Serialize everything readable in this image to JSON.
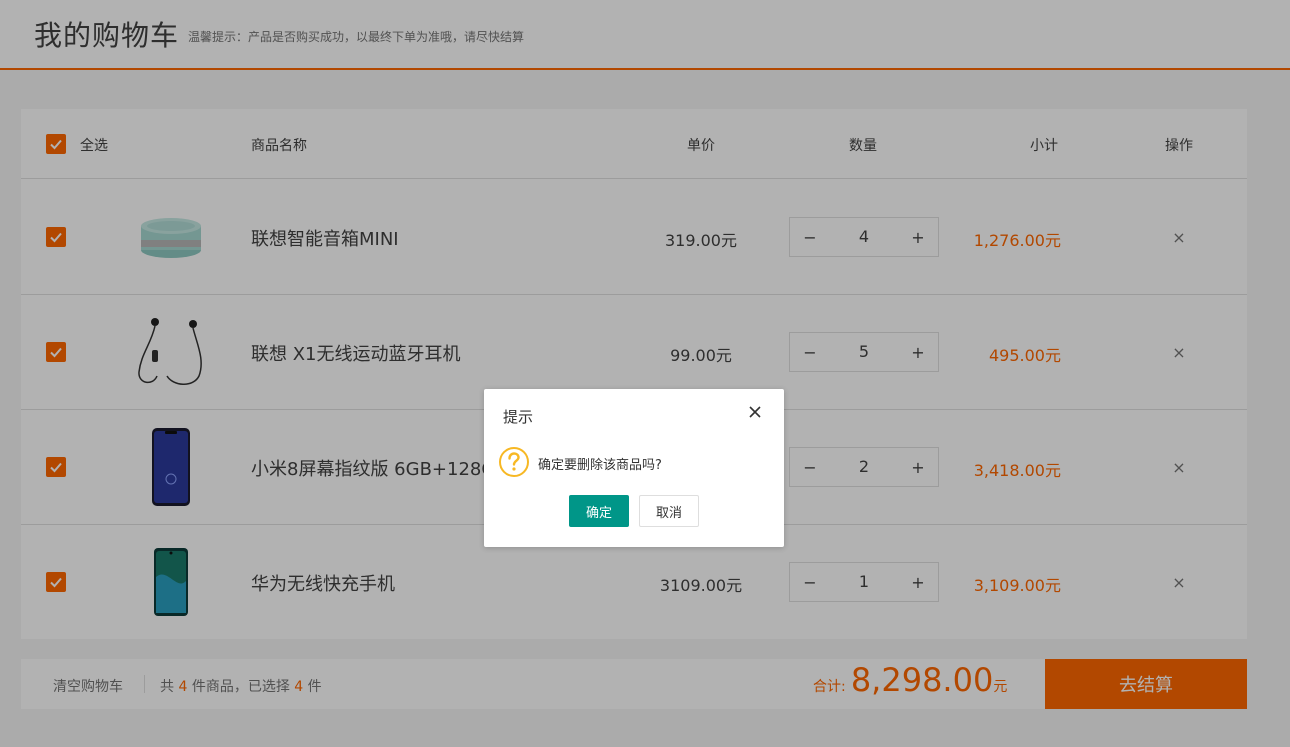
{
  "header": {
    "title": "我的购物车",
    "tip": "温馨提示：产品是否购买成功，以最终下单为准哦，请尽快结算"
  },
  "table_head": {
    "select_all": "全选",
    "name": "商品名称",
    "price": "单价",
    "quantity": "数量",
    "subtotal": "小计",
    "action": "操作"
  },
  "items": [
    {
      "name": "联想智能音箱MINI",
      "price": "319.00元",
      "qty": "4",
      "subtotal": "1,276.00元",
      "checked": true,
      "image": "smart-speaker"
    },
    {
      "name": "联想 X1无线运动蓝牙耳机",
      "price": "99.00元",
      "qty": "5",
      "subtotal": "495.00元",
      "checked": true,
      "image": "earphones"
    },
    {
      "name": "小米8屏幕指纹版 6GB+128GB",
      "price": "",
      "qty": "2",
      "subtotal": "3,418.00元",
      "checked": true,
      "image": "phone"
    },
    {
      "name": "华为无线快充手机",
      "price": "3109.00元",
      "qty": "1",
      "subtotal": "3,109.00元",
      "checked": true,
      "image": "phone"
    }
  ],
  "stepper": {
    "minus": "−",
    "plus": "+"
  },
  "delete_symbol": "×",
  "footer": {
    "clear": "清空购物车",
    "count_prefix": "共 ",
    "count_total": "4",
    "count_mid": " 件商品，已选择 ",
    "count_selected": "4",
    "count_suffix": " 件",
    "total_label": "合计:",
    "total_amount": "8,298.00",
    "total_unit": "元",
    "checkout": "去结算"
  },
  "dialog": {
    "title": "提示",
    "message": "确定要删除该商品吗?",
    "ok": "确定",
    "cancel": "取消",
    "icon": "question-icon"
  },
  "colors": {
    "accent": "#ff6700",
    "confirm": "#009688",
    "warning": "#f7b824"
  }
}
